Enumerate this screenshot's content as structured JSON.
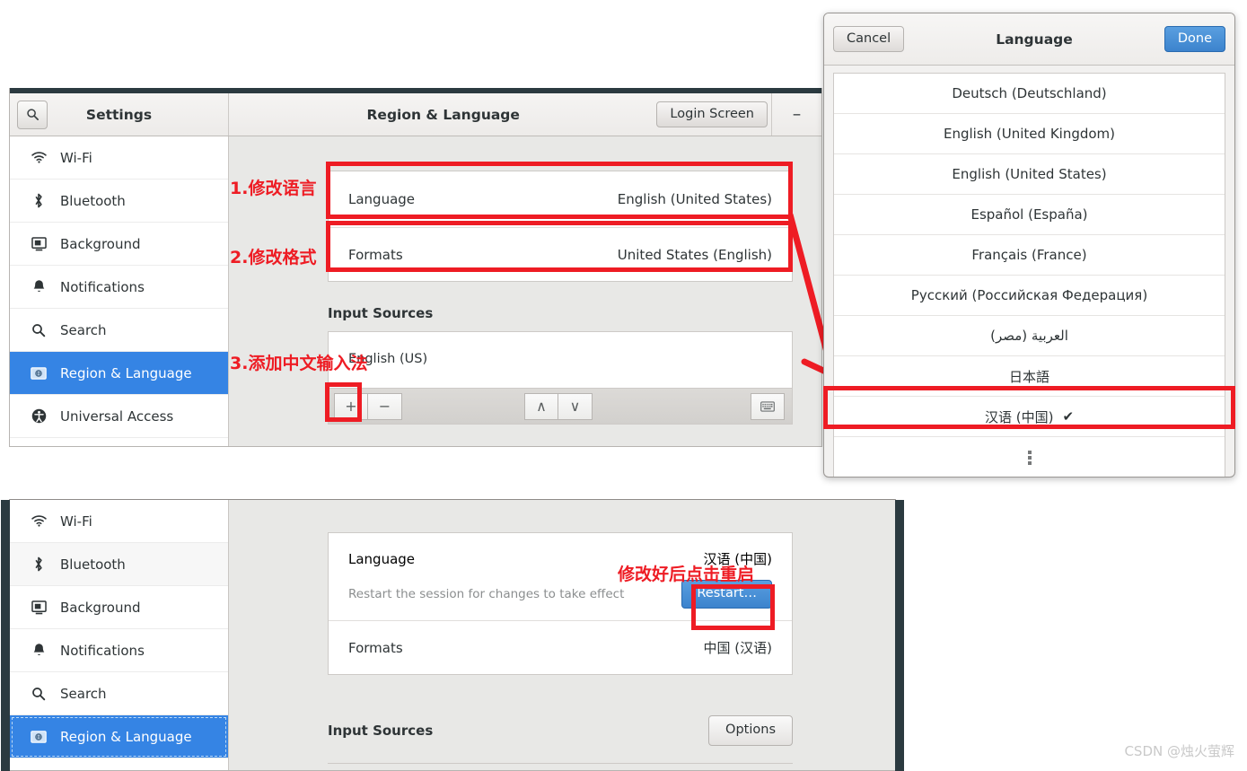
{
  "top_window": {
    "titlebar": {
      "search_icon": "search-icon",
      "app_title": "Settings",
      "panel_title": "Region & Language",
      "login_screen_button": "Login Screen",
      "minimize_button": "–"
    },
    "sidebar": [
      {
        "label": "Wi-Fi",
        "icon": "wifi-icon",
        "selected": false
      },
      {
        "label": "Bluetooth",
        "icon": "bluetooth-icon",
        "selected": false
      },
      {
        "label": "Background",
        "icon": "background-icon",
        "selected": false
      },
      {
        "label": "Notifications",
        "icon": "bell-icon",
        "selected": false
      },
      {
        "label": "Search",
        "icon": "search-icon",
        "selected": false
      },
      {
        "label": "Region & Language",
        "icon": "region-icon",
        "selected": true
      },
      {
        "label": "Universal Access",
        "icon": "accessibility-icon",
        "selected": false
      }
    ],
    "language_row": {
      "label": "Language",
      "value": "English (United States)"
    },
    "formats_row": {
      "label": "Formats",
      "value": "United States (English)"
    },
    "input_sources": {
      "heading": "Input Sources",
      "items": [
        "English (US)"
      ],
      "toolbar": {
        "add": "+",
        "remove": "−",
        "move_up": "∧",
        "move_down": "∨",
        "keyboard_preview": "keyboard-icon"
      }
    }
  },
  "language_dialog": {
    "cancel_label": "Cancel",
    "title": "Language",
    "done_label": "Done",
    "items": [
      {
        "label": "Deutsch (Deutschland)",
        "checked": false
      },
      {
        "label": "English (United Kingdom)",
        "checked": false
      },
      {
        "label": "English (United States)",
        "checked": false
      },
      {
        "label": "Español (España)",
        "checked": false
      },
      {
        "label": "Français (France)",
        "checked": false
      },
      {
        "label": "Русский (Российская Федерация)",
        "checked": false
      },
      {
        "label": "العربية (مصر)",
        "checked": false
      },
      {
        "label": "日本語",
        "checked": false
      },
      {
        "label": "汉语 (中国)",
        "checked": true
      }
    ],
    "more_indicator": "more-dots-icon"
  },
  "bottom_window": {
    "sidebar": [
      {
        "label": "Wi-Fi",
        "icon": "wifi-icon",
        "selected": false
      },
      {
        "label": "Bluetooth",
        "icon": "bluetooth-icon",
        "selected": false
      },
      {
        "label": "Background",
        "icon": "background-icon",
        "selected": false
      },
      {
        "label": "Notifications",
        "icon": "bell-icon",
        "selected": false
      },
      {
        "label": "Search",
        "icon": "search-icon",
        "selected": false
      },
      {
        "label": "Region & Language",
        "icon": "region-icon",
        "selected": true
      }
    ],
    "language_row": {
      "label": "Language",
      "value": "汉语 (中国)"
    },
    "restart_note": "Restart the session for changes to take effect",
    "restart_button": "Restart…",
    "formats_row": {
      "label": "Formats",
      "value": "中国 (汉语)"
    },
    "input_sources": {
      "heading": "Input Sources",
      "options_button": "Options"
    }
  },
  "annotations": {
    "step1": "1.修改语言",
    "step2": "2.修改格式",
    "step3": "3.添加中文输入法",
    "step4": "修改好后点击重启",
    "accent_red": "#ee1c24",
    "accent_blue": "#3584e4"
  },
  "watermark": "CSDN @烛火萤辉"
}
